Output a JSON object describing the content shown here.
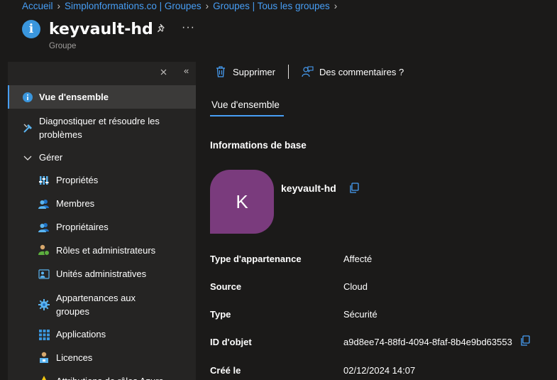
{
  "breadcrumb": [
    "Accueil",
    "Simplonformations.co | Groupes",
    "Groupes | Tous les groupes"
  ],
  "header": {
    "title": "keyvault-hd",
    "subtitle": "Groupe",
    "more": "···"
  },
  "toolbar": {
    "delete_label": "Supprimer",
    "feedback_label": "Des commentaires ?"
  },
  "sidebar": {
    "items": [
      {
        "label": "Vue d'ensemble",
        "icon": "info-icon",
        "active": true
      },
      {
        "label": "Diagnostiquer et résoudre les",
        "label2": "problèmes",
        "icon": "wrench-icon"
      },
      {
        "label": "Gérer",
        "icon": "chevron-down-icon",
        "group": true
      },
      {
        "label": "Propriétés",
        "icon": "properties-icon"
      },
      {
        "label": "Membres",
        "icon": "members-icon"
      },
      {
        "label": "Propriétaires",
        "icon": "owners-icon"
      },
      {
        "label": "Rôles et administrateurs",
        "icon": "roles-icon"
      },
      {
        "label": "Unités administratives",
        "icon": "admin-units-icon"
      },
      {
        "label": "Appartenances aux",
        "label2": "groupes",
        "icon": "group-memberships-icon"
      },
      {
        "label": "Applications",
        "icon": "applications-icon"
      },
      {
        "label": "Licences",
        "icon": "licenses-icon"
      },
      {
        "label": "Attributions de rôles Azure",
        "icon": "azure-roles-icon"
      }
    ]
  },
  "main": {
    "tab": "Vue d'ensemble",
    "section_title": "Informations de base",
    "avatar_letter": "K",
    "avatar_color": "#7a3b7d",
    "entity_name": "keyvault-hd",
    "properties": [
      {
        "label": "Type d'appartenance",
        "value": "Affecté"
      },
      {
        "label": "Source",
        "value": "Cloud"
      },
      {
        "label": "Type",
        "value": "Sécurité"
      },
      {
        "label": "ID d'objet",
        "value": "a9d8ee74-88fd-4094-8faf-8b4e9bd63553"
      },
      {
        "label": "Créé le",
        "value": "02/12/2024 14:07"
      }
    ]
  },
  "colors": {
    "accent": "#479ef5",
    "background": "#1b1a19",
    "sidebar": "#252423"
  }
}
